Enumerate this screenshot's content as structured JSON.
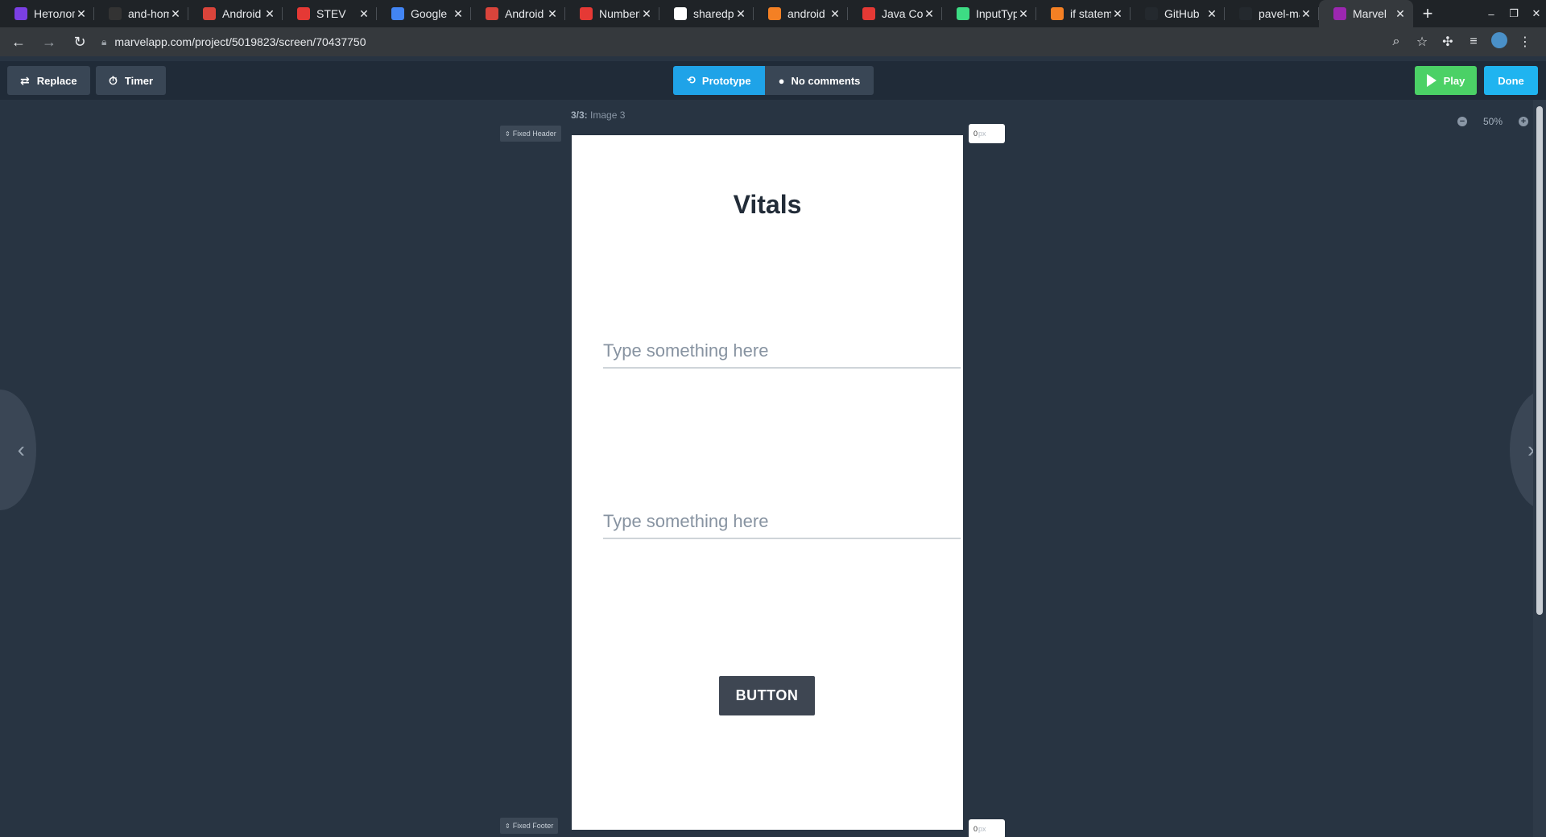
{
  "browser": {
    "tabs": [
      {
        "title": "Нетолог",
        "color": "#7b3fe4"
      },
      {
        "title": "and-hom",
        "color": "#333333"
      },
      {
        "title": "Android",
        "color": "#d9443b"
      },
      {
        "title": "STEV",
        "color": "#e53935"
      },
      {
        "title": "Google",
        "color": "#4285f4"
      },
      {
        "title": "Android",
        "color": "#d9443b"
      },
      {
        "title": "NumberP",
        "color": "#e53935"
      },
      {
        "title": "sharedpr",
        "color": "#ffffff"
      },
      {
        "title": "android",
        "color": "#f48024"
      },
      {
        "title": "Java Co",
        "color": "#e53935"
      },
      {
        "title": "InputTyp",
        "color": "#3ddc84"
      },
      {
        "title": "if statem",
        "color": "#f48024"
      },
      {
        "title": "GitHub",
        "color": "#24292e"
      },
      {
        "title": "pavel-ma",
        "color": "#24292e"
      },
      {
        "title": "Marvel",
        "color": "#9c27b0"
      }
    ],
    "close_glyph": "✕",
    "new_tab_glyph": "+",
    "url": "marvelapp.com/project/5019823/screen/70437750"
  },
  "toolbar": {
    "replace_label": "Replace",
    "timer_label": "Timer",
    "prototype_label": "Prototype",
    "comments_label": "No comments",
    "play_label": "Play",
    "done_label": "Done"
  },
  "workspace": {
    "screen_index": "3/3:",
    "screen_name": "Image 3",
    "fixed_header_label": "Fixed Header",
    "fixed_footer_label": "Fixed Footer",
    "header_px_value": "0",
    "footer_px_value": "0",
    "px_unit": "px",
    "zoom_level": "50%"
  },
  "phone": {
    "title": "Vitals",
    "field1_placeholder": "Type something here",
    "field2_placeholder": "Type something here",
    "button_label": "BUTTON"
  }
}
